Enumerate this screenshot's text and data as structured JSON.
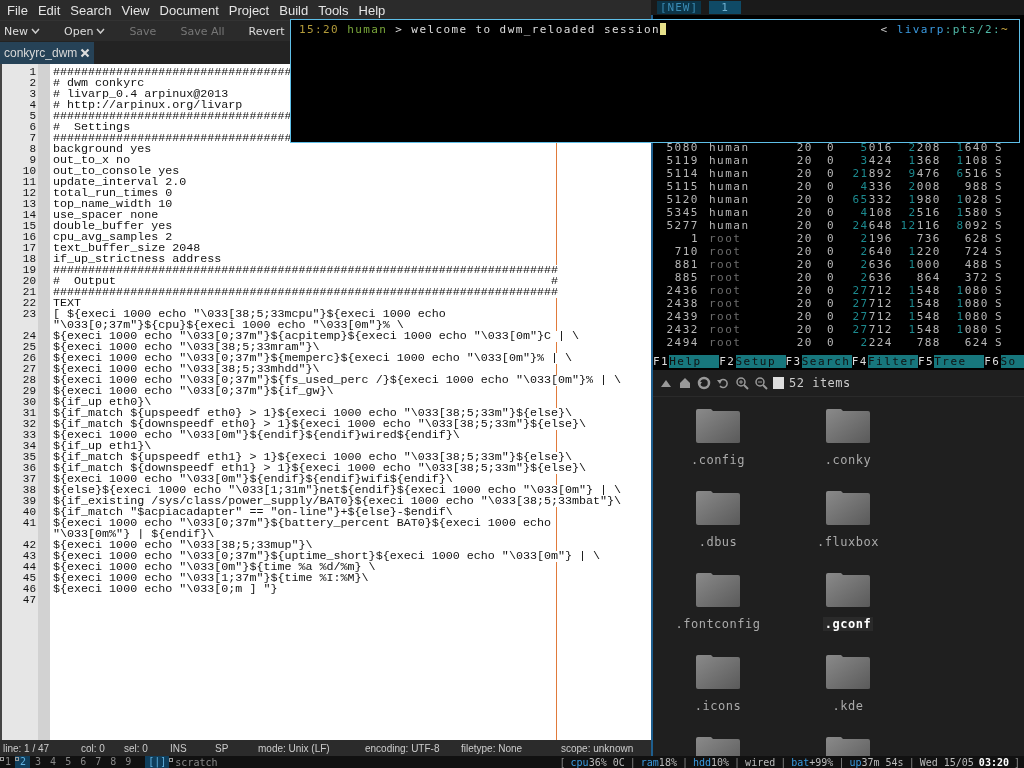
{
  "editor_window": {
    "menu": [
      "File",
      "Edit",
      "Search",
      "View",
      "Document",
      "Project",
      "Build",
      "Tools",
      "Help"
    ],
    "toolbar": [
      {
        "label": "New",
        "dropdown": true,
        "disabled": false
      },
      {
        "label": "Open",
        "dropdown": true,
        "disabled": false
      },
      {
        "label": "Save",
        "dropdown": false,
        "disabled": true
      },
      {
        "label": "Save All",
        "dropdown": false,
        "disabled": true
      },
      {
        "label": "Revert",
        "dropdown": false,
        "disabled": false
      }
    ],
    "tabs": [
      {
        "label": "conkyrc_dwm",
        "selected": true
      }
    ],
    "lines": [
      {
        "number": "1",
        "text": "##################################"
      },
      {
        "number": "2",
        "text": "# dwm conkyrc"
      },
      {
        "number": "3",
        "text": "# livarp_0.4 arpinux@2013"
      },
      {
        "number": "4",
        "text": "# http://arpinux.org/livarp"
      },
      {
        "number": "5",
        "text": "##################################"
      },
      {
        "number": "6",
        "text": "#  Settings"
      },
      {
        "number": "7",
        "text": "##################################"
      },
      {
        "number": "8",
        "text": "background yes"
      },
      {
        "number": "9",
        "text": "out_to_x no"
      },
      {
        "number": "10",
        "text": "out_to_console yes"
      },
      {
        "number": "11",
        "text": "update_interval 2.0"
      },
      {
        "number": "12",
        "text": "total_run_times 0"
      },
      {
        "number": "13",
        "text": "top_name_width 10"
      },
      {
        "number": "14",
        "text": "use_spacer none"
      },
      {
        "number": "15",
        "text": "double_buffer yes"
      },
      {
        "number": "16",
        "text": "cpu_avg_samples 2"
      },
      {
        "number": "17",
        "text": "text_buffer_size 2048"
      },
      {
        "number": "18",
        "text": "if_up_strictness address"
      },
      {
        "number": "19",
        "text": "########################################################################"
      },
      {
        "number": "20",
        "text": "#  Output                                                              #"
      },
      {
        "number": "21",
        "text": "########################################################################"
      },
      {
        "number": "22",
        "text": "TEXT"
      },
      {
        "number": "23",
        "text": "[ ${execi 1000 echo \"\\033[38;5;33mcpu\"}${execi 1000 echo",
        "continuation": "\"\\033[0;37m\"}${cpu}${execi 1000 echo \"\\033[0m\"}% \\"
      },
      {
        "number": "24",
        "text": "${execi 1000 echo \"\\033[0;37m\"}${acpitemp}${execi 1000 echo \"\\033[0m\"}C | \\"
      },
      {
        "number": "25",
        "text": "${execi 1000 echo \"\\033[38;5;33mram\"}\\"
      },
      {
        "number": "26",
        "text": "${execi 1000 echo \"\\033[0;37m\"}${memperc}${execi 1000 echo \"\\033[0m\"}% | \\"
      },
      {
        "number": "27",
        "text": "${execi 1000 echo \"\\033[38;5;33mhdd\"}\\"
      },
      {
        "number": "28",
        "text": "${execi 1000 echo \"\\033[0;37m\"}${fs_used_perc /}${execi 1000 echo \"\\033[0m\"}% | \\"
      },
      {
        "number": "29",
        "text": "${execi 1000 echo \"\\033[0;37m\"}${if_gw}\\"
      },
      {
        "number": "30",
        "text": "${if_up eth0}\\"
      },
      {
        "number": "31",
        "text": "${if_match ${upspeedf eth0} > 1}${execi 1000 echo \"\\033[38;5;33m\"}${else}\\"
      },
      {
        "number": "32",
        "text": "${if_match ${downspeedf eth0} > 1}${execi 1000 echo \"\\033[38;5;33m\"}${else}\\"
      },
      {
        "number": "33",
        "text": "${execi 1000 echo \"\\033[0m\"}${endif}${endif}wired${endif}\\"
      },
      {
        "number": "34",
        "text": "${if_up eth1}\\"
      },
      {
        "number": "35",
        "text": "${if_match ${upspeedf eth1} > 1}${execi 1000 echo \"\\033[38;5;33m\"}${else}\\"
      },
      {
        "number": "36",
        "text": "${if_match ${downspeedf eth1} > 1}${execi 1000 echo \"\\033[38;5;33m\"}${else}\\"
      },
      {
        "number": "37",
        "text": "${execi 1000 echo \"\\033[0m\"}${endif}${endif}wifi${endif}\\"
      },
      {
        "number": "38",
        "text": "${else}${execi 1000 echo \"\\033[1;31m\"}net${endif}${execi 1000 echo \"\\033[0m\"} | \\"
      },
      {
        "number": "39",
        "text": "${if_existing /sys/class/power_supply/BAT0}${execi 1000 echo \"\\033[38;5;33mbat\"}\\"
      },
      {
        "number": "40",
        "text": "${if_match \"$acpiacadapter\" == \"on-line\"}+${else}-$endif\\"
      },
      {
        "number": "41",
        "text": "${execi 1000 echo \"\\033[0;37m\"}${battery_percent BAT0}${execi 1000 echo",
        "continuation": "\"\\033[0m%\"} | ${endif}\\"
      },
      {
        "number": "42",
        "text": "${execi 1000 echo \"\\033[38;5;33mup\"}\\"
      },
      {
        "number": "43",
        "text": "${execi 1000 echo \"\\033[0;37m\"}${uptime_short}${execi 1000 echo \"\\033[0m\"} | \\"
      },
      {
        "number": "44",
        "text": "${execi 1000 echo \"\\033[0m\"}${time %a %d/%m} \\"
      },
      {
        "number": "45",
        "text": "${execi 1000 echo \"\\033[1;37m\"}${time %I:%M}\\"
      },
      {
        "number": "46",
        "text": "${execi 1000 echo \"\\033[0;m ] \"}"
      },
      {
        "number": "47"
      }
    ],
    "status_bar": [
      "line: 1 / 47",
      "col: 0",
      "sel: 0",
      "INS",
      "SP",
      "mode: Unix (LF)",
      "encoding: UTF-8",
      "filetype: None",
      "scope: unknown"
    ]
  },
  "terminal": {
    "time": "15:20",
    "user": "human",
    "message": "> welcome to dwm_reloaded session",
    "right_marker": "<",
    "host": "livarp",
    "tty": ":pts/2:",
    "dir": "~"
  },
  "tmux_bar": [
    "[NEW]",
    "1"
  ],
  "htop": {
    "rows": [
      {
        "pid": "5080",
        "user": "human",
        "pri": "20",
        "ni": "0",
        "virt": "5016",
        "res": "2208",
        "shr": "1640",
        "state": "S",
        "dimmed": false
      },
      {
        "pid": "5119",
        "user": "human",
        "pri": "20",
        "ni": "0",
        "virt": "3424",
        "res": "1368",
        "shr": "1108",
        "state": "S",
        "dimmed": false
      },
      {
        "pid": "5114",
        "user": "human",
        "pri": "20",
        "ni": "0",
        "virt": "21892",
        "res": "9476",
        "shr": "6516",
        "state": "S",
        "dimmed": false
      },
      {
        "pid": "5115",
        "user": "human",
        "pri": "20",
        "ni": "0",
        "virt": "4336",
        "res": "2008",
        "shr": "988",
        "state": "S",
        "dimmed": false
      },
      {
        "pid": "5120",
        "user": "human",
        "pri": "20",
        "ni": "0",
        "virt": "65332",
        "res": "1980",
        "shr": "1028",
        "state": "S",
        "dimmed": false
      },
      {
        "pid": "5345",
        "user": "human",
        "pri": "20",
        "ni": "0",
        "virt": "4108",
        "res": "2516",
        "shr": "1580",
        "state": "S",
        "dimmed": false
      },
      {
        "pid": "5277",
        "user": "human",
        "pri": "20",
        "ni": "0",
        "virt": "24648",
        "res": "12116",
        "shr": "8092",
        "state": "S",
        "dimmed": false
      },
      {
        "pid": "1",
        "user": "root",
        "pri": "20",
        "ni": "0",
        "virt": "2196",
        "res": "736",
        "shr": "628",
        "state": "S",
        "dimmed": true
      },
      {
        "pid": "710",
        "user": "root",
        "pri": "20",
        "ni": "0",
        "virt": "2640",
        "res": "1220",
        "shr": "724",
        "state": "S",
        "dimmed": true
      },
      {
        "pid": "881",
        "user": "root",
        "pri": "20",
        "ni": "0",
        "virt": "2636",
        "res": "1000",
        "shr": "488",
        "state": "S",
        "dimmed": true
      },
      {
        "pid": "885",
        "user": "root",
        "pri": "20",
        "ni": "0",
        "virt": "2636",
        "res": "864",
        "shr": "372",
        "state": "S",
        "dimmed": true
      },
      {
        "pid": "2436",
        "user": "root",
        "pri": "20",
        "ni": "0",
        "virt": "27712",
        "res": "1548",
        "shr": "1080",
        "state": "S",
        "dimmed": true
      },
      {
        "pid": "2438",
        "user": "root",
        "pri": "20",
        "ni": "0",
        "virt": "27712",
        "res": "1548",
        "shr": "1080",
        "state": "S",
        "dimmed": true
      },
      {
        "pid": "2439",
        "user": "root",
        "pri": "20",
        "ni": "0",
        "virt": "27712",
        "res": "1548",
        "shr": "1080",
        "state": "S",
        "dimmed": true
      },
      {
        "pid": "2432",
        "user": "root",
        "pri": "20",
        "ni": "0",
        "virt": "27712",
        "res": "1548",
        "shr": "1080",
        "state": "S",
        "dimmed": true
      },
      {
        "pid": "2494",
        "user": "root",
        "pri": "20",
        "ni": "0",
        "virt": "2224",
        "res": "788",
        "shr": "624",
        "state": "S",
        "dimmed": true
      }
    ],
    "function_keys": [
      {
        "key": "F1",
        "label": "Help"
      },
      {
        "key": "F2",
        "label": "Setup"
      },
      {
        "key": "F3",
        "label": "Search"
      },
      {
        "key": "F4",
        "label": "Filter"
      },
      {
        "key": "F5",
        "label": "Tree"
      },
      {
        "key": "F6",
        "label": "So"
      }
    ]
  },
  "file_manager": {
    "item_count": "52 items",
    "items": [
      {
        "kind": "folder",
        "name": ".config",
        "selected": false
      },
      {
        "kind": "folder",
        "name": ".conky",
        "selected": false
      },
      {
        "kind": "folder",
        "name": ".dbus",
        "selected": false
      },
      {
        "kind": "folder",
        "name": ".fluxbox",
        "selected": false
      },
      {
        "kind": "folder",
        "name": ".fontconfig",
        "selected": false
      },
      {
        "kind": "folder",
        "name": ".gconf",
        "selected": true
      },
      {
        "kind": "folder",
        "name": ".icons",
        "selected": false
      },
      {
        "kind": "folder",
        "name": ".kde",
        "selected": false
      },
      {
        "kind": "folder"
      },
      {
        "kind": "folder"
      }
    ]
  },
  "dwm_bar": {
    "tags": [
      {
        "label": "1",
        "occupied": true,
        "selected": false
      },
      {
        "label": "2",
        "occupied": true,
        "selected": true
      },
      {
        "label": "3",
        "occupied": false,
        "selected": false
      },
      {
        "label": "4",
        "occupied": false,
        "selected": false
      },
      {
        "label": "5",
        "occupied": false,
        "selected": false
      },
      {
        "label": "6",
        "occupied": false,
        "selected": false
      },
      {
        "label": "7",
        "occupied": false,
        "selected": false
      },
      {
        "label": "8",
        "occupied": false,
        "selected": false
      },
      {
        "label": "9",
        "occupied": false,
        "selected": false
      }
    ],
    "layout": "[|]",
    "scratch": {
      "label": "scratch",
      "occupied": true
    },
    "status": [
      {
        "kind": "bracket",
        "text": "["
      },
      {
        "kind": "metric",
        "label": "cpu",
        "value": "36% 0C"
      },
      {
        "kind": "sep",
        "text": "|"
      },
      {
        "kind": "metric",
        "label": "ram",
        "value": "18%"
      },
      {
        "kind": "sep",
        "text": "|"
      },
      {
        "kind": "metric",
        "label": "hdd",
        "value": "10%"
      },
      {
        "kind": "sep",
        "text": "|"
      },
      {
        "kind": "plain",
        "text": "wired"
      },
      {
        "kind": "sep",
        "text": "|"
      },
      {
        "kind": "metric",
        "label": "bat",
        "value": "+99%"
      },
      {
        "kind": "sep",
        "text": "|"
      },
      {
        "kind": "metric",
        "label": "up",
        "value": "37m 54s"
      },
      {
        "kind": "sep",
        "text": "|"
      },
      {
        "kind": "plain",
        "text": "Wed 15/05"
      },
      {
        "kind": "strong",
        "text": "03:20"
      },
      {
        "kind": "bracket",
        "text": "]"
      }
    ]
  }
}
